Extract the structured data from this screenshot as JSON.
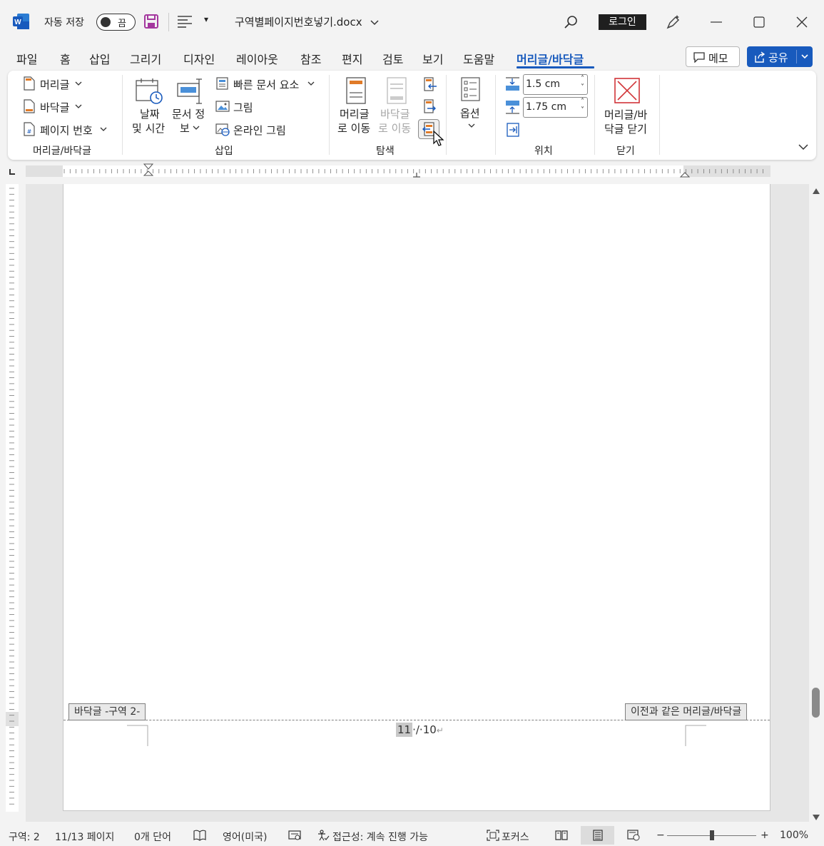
{
  "titlebar": {
    "autosave_label": "자동 저장",
    "toggle_state": "끔",
    "document_title": "구역별페이지번호넣기.docx",
    "login_label": "로그인"
  },
  "tabs": [
    {
      "label": "파일"
    },
    {
      "label": "홈"
    },
    {
      "label": "삽입"
    },
    {
      "label": "그리기"
    },
    {
      "label": "디자인"
    },
    {
      "label": "레이아웃"
    },
    {
      "label": "참조"
    },
    {
      "label": "편지"
    },
    {
      "label": "검토"
    },
    {
      "label": "보기"
    },
    {
      "label": "도움말"
    },
    {
      "label": "머리글/바닥글"
    }
  ],
  "actions": {
    "memo_label": "메모",
    "share_label": "공유"
  },
  "ribbon": {
    "hf": {
      "header": "머리글",
      "footer": "바닥글",
      "page_number": "페이지 번호",
      "label": "머리글/바닥글"
    },
    "insert": {
      "datetime_l1": "날짜",
      "datetime_l2": "및 시간",
      "docinfo_l1": "문서 정",
      "docinfo_l2": "보",
      "quickparts": "빠른 문서 요소",
      "picture": "그림",
      "online_picture": "온라인 그림",
      "label": "삽입"
    },
    "nav": {
      "goto_header_l1": "머리글",
      "goto_header_l2": "로 이동",
      "goto_footer_l1": "바닥글",
      "goto_footer_l2": "로 이동",
      "label": "탐색"
    },
    "options": {
      "label": "옵션"
    },
    "position": {
      "header_top": "1.5 cm",
      "footer_bottom": "1.75 cm",
      "label": "위치"
    },
    "close": {
      "btn_l1": "머리글/바",
      "btn_l2": "닥글 닫기",
      "label": "닫기"
    }
  },
  "document": {
    "footer_tag_left": "바닥글 -구역 2-",
    "footer_tag_right": "이전과 같은 머리글/바닥글",
    "page_current": "11",
    "page_sep": "·/·",
    "page_total": "10",
    "para_mark": "↵"
  },
  "statusbar": {
    "section": "구역: 2",
    "pages": "11/13 페이지",
    "words": "0개 단어",
    "language": "영어(미국)",
    "accessibility": "접근성: 계속 진행 가능",
    "focus": "포커스",
    "zoom": "100%",
    "zoom_minus": "−",
    "zoom_plus": "+"
  }
}
